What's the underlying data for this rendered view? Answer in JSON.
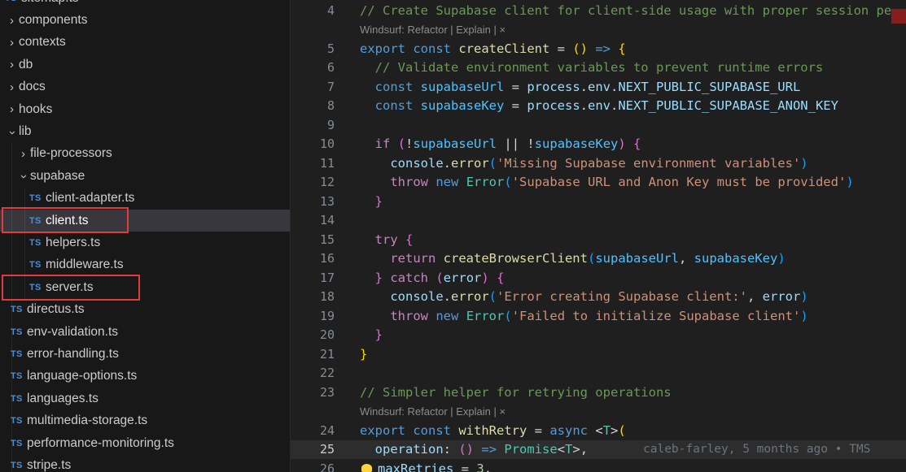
{
  "sidebar": {
    "items": [
      {
        "label": "sitemap.ts",
        "kind": "file",
        "level": 0,
        "partial": true
      },
      {
        "label": "components",
        "kind": "folder",
        "level": 0,
        "expanded": false
      },
      {
        "label": "contexts",
        "kind": "folder",
        "level": 0,
        "expanded": false
      },
      {
        "label": "db",
        "kind": "folder",
        "level": 0,
        "expanded": false
      },
      {
        "label": "docs",
        "kind": "folder",
        "level": 0,
        "expanded": false
      },
      {
        "label": "hooks",
        "kind": "folder",
        "level": 0,
        "expanded": false
      },
      {
        "label": "lib",
        "kind": "folder",
        "level": 0,
        "expanded": true
      },
      {
        "label": "file-processors",
        "kind": "folder",
        "level": 1,
        "expanded": false
      },
      {
        "label": "supabase",
        "kind": "folder",
        "level": 1,
        "expanded": true
      },
      {
        "label": "client-adapter.ts",
        "kind": "file",
        "level": 2
      },
      {
        "label": "client.ts",
        "kind": "file",
        "level": 2,
        "selected": true,
        "annotated": true
      },
      {
        "label": "helpers.ts",
        "kind": "file",
        "level": 2
      },
      {
        "label": "middleware.ts",
        "kind": "file",
        "level": 2
      },
      {
        "label": "server.ts",
        "kind": "file",
        "level": 2,
        "annotated": true
      },
      {
        "label": "directus.ts",
        "kind": "file",
        "level": 1
      },
      {
        "label": "env-validation.ts",
        "kind": "file",
        "level": 1
      },
      {
        "label": "error-handling.ts",
        "kind": "file",
        "level": 1
      },
      {
        "label": "language-options.ts",
        "kind": "file",
        "level": 1
      },
      {
        "label": "languages.ts",
        "kind": "file",
        "level": 1
      },
      {
        "label": "multimedia-storage.ts",
        "kind": "file",
        "level": 1
      },
      {
        "label": "performance-monitoring.ts",
        "kind": "file",
        "level": 1
      },
      {
        "label": "stripe.ts",
        "kind": "file",
        "level": 1,
        "partial": true
      }
    ]
  },
  "annotations": {
    "boxes": [
      "client.ts",
      "server.ts"
    ],
    "color": "#e03c3c"
  },
  "editor": {
    "rows": [
      {
        "n": "4",
        "tokens": [
          [
            "// Create Supabase client for client-side usage with proper session pe",
            "cm"
          ]
        ]
      },
      {
        "n": "",
        "lens": true,
        "tokens": [
          [
            "Windsurf: Refactor",
            "lens",
            "codelens-refactor-link",
            true
          ],
          [
            " | ",
            "lens"
          ],
          [
            "Explain",
            "lens",
            "codelens-explain-link",
            true
          ],
          [
            " | ",
            "lens"
          ],
          [
            "×",
            "lens-close",
            "codelens-dismiss-icon",
            true
          ]
        ]
      },
      {
        "n": "5",
        "tokens": [
          [
            "export ",
            "kw"
          ],
          [
            "const ",
            "kw"
          ],
          [
            "createClient",
            "fn"
          ],
          [
            " = ",
            "pl"
          ],
          [
            "()",
            "b1"
          ],
          [
            " ",
            "pl"
          ],
          [
            "=>",
            "kw"
          ],
          [
            " ",
            "pl"
          ],
          [
            "{",
            "b1"
          ]
        ]
      },
      {
        "n": "6",
        "tokens": [
          [
            "  ",
            "pl"
          ],
          [
            "// Validate environment variables to prevent runtime errors",
            "cm"
          ]
        ]
      },
      {
        "n": "7",
        "tokens": [
          [
            "  ",
            "pl"
          ],
          [
            "const ",
            "kw"
          ],
          [
            "supabaseUrl",
            "cv"
          ],
          [
            " = ",
            "pl"
          ],
          [
            "process",
            "vr"
          ],
          [
            ".",
            "pl"
          ],
          [
            "env",
            "vr"
          ],
          [
            ".",
            "pl"
          ],
          [
            "NEXT_PUBLIC_SUPABASE_URL",
            "vr"
          ]
        ]
      },
      {
        "n": "8",
        "tokens": [
          [
            "  ",
            "pl"
          ],
          [
            "const ",
            "kw"
          ],
          [
            "supabaseKey",
            "cv"
          ],
          [
            " = ",
            "pl"
          ],
          [
            "process",
            "vr"
          ],
          [
            ".",
            "pl"
          ],
          [
            "env",
            "vr"
          ],
          [
            ".",
            "pl"
          ],
          [
            "NEXT_PUBLIC_SUPABASE_ANON_KEY",
            "vr"
          ]
        ]
      },
      {
        "n": "9",
        "tokens": []
      },
      {
        "n": "10",
        "tokens": [
          [
            "  ",
            "pl"
          ],
          [
            "if",
            "ctl"
          ],
          [
            " ",
            "pl"
          ],
          [
            "(",
            "b2"
          ],
          [
            "!",
            "pl"
          ],
          [
            "supabaseUrl",
            "cv"
          ],
          [
            " || ",
            "pl"
          ],
          [
            "!",
            "pl"
          ],
          [
            "supabaseKey",
            "cv"
          ],
          [
            ")",
            "b2"
          ],
          [
            " ",
            "pl"
          ],
          [
            "{",
            "b2"
          ]
        ]
      },
      {
        "n": "11",
        "tokens": [
          [
            "    ",
            "pl"
          ],
          [
            "console",
            "vr"
          ],
          [
            ".",
            "pl"
          ],
          [
            "error",
            "fn"
          ],
          [
            "(",
            "b3"
          ],
          [
            "'Missing Supabase environment variables'",
            "st"
          ],
          [
            ")",
            "b3"
          ]
        ]
      },
      {
        "n": "12",
        "tokens": [
          [
            "    ",
            "pl"
          ],
          [
            "throw",
            "ctl"
          ],
          [
            " ",
            "pl"
          ],
          [
            "new",
            "kw"
          ],
          [
            " ",
            "pl"
          ],
          [
            "Error",
            "cl"
          ],
          [
            "(",
            "b3"
          ],
          [
            "'Supabase URL and Anon Key must be provided'",
            "st"
          ],
          [
            ")",
            "b3"
          ]
        ]
      },
      {
        "n": "13",
        "tokens": [
          [
            "  ",
            "pl"
          ],
          [
            "}",
            "b2"
          ]
        ]
      },
      {
        "n": "14",
        "tokens": []
      },
      {
        "n": "15",
        "tokens": [
          [
            "  ",
            "pl"
          ],
          [
            "try",
            "ctl"
          ],
          [
            " ",
            "pl"
          ],
          [
            "{",
            "b2"
          ]
        ]
      },
      {
        "n": "16",
        "tokens": [
          [
            "    ",
            "pl"
          ],
          [
            "return",
            "ctl"
          ],
          [
            " ",
            "pl"
          ],
          [
            "createBrowserClient",
            "fn"
          ],
          [
            "(",
            "b3"
          ],
          [
            "supabaseUrl",
            "cv"
          ],
          [
            ", ",
            "pl"
          ],
          [
            "supabaseKey",
            "cv"
          ],
          [
            ")",
            "b3"
          ]
        ]
      },
      {
        "n": "17",
        "tokens": [
          [
            "  ",
            "pl"
          ],
          [
            "}",
            "b2"
          ],
          [
            " ",
            "pl"
          ],
          [
            "catch",
            "ctl"
          ],
          [
            " ",
            "pl"
          ],
          [
            "(",
            "b2"
          ],
          [
            "error",
            "vr"
          ],
          [
            ")",
            "b2"
          ],
          [
            " ",
            "pl"
          ],
          [
            "{",
            "b2"
          ]
        ]
      },
      {
        "n": "18",
        "tokens": [
          [
            "    ",
            "pl"
          ],
          [
            "console",
            "vr"
          ],
          [
            ".",
            "pl"
          ],
          [
            "error",
            "fn"
          ],
          [
            "(",
            "b3"
          ],
          [
            "'Error creating Supabase client:'",
            "st"
          ],
          [
            ", ",
            "pl"
          ],
          [
            "error",
            "vr"
          ],
          [
            ")",
            "b3"
          ]
        ]
      },
      {
        "n": "19",
        "tokens": [
          [
            "    ",
            "pl"
          ],
          [
            "throw",
            "ctl"
          ],
          [
            " ",
            "pl"
          ],
          [
            "new",
            "kw"
          ],
          [
            " ",
            "pl"
          ],
          [
            "Error",
            "cl"
          ],
          [
            "(",
            "b3"
          ],
          [
            "'Failed to initialize Supabase client'",
            "st"
          ],
          [
            ")",
            "b3"
          ]
        ]
      },
      {
        "n": "20",
        "tokens": [
          [
            "  ",
            "pl"
          ],
          [
            "}",
            "b2"
          ]
        ]
      },
      {
        "n": "21",
        "tokens": [
          [
            "}",
            "b1"
          ]
        ]
      },
      {
        "n": "22",
        "tokens": []
      },
      {
        "n": "23",
        "tokens": [
          [
            "// Simpler helper for retrying operations",
            "cm"
          ]
        ]
      },
      {
        "n": "",
        "lens": true,
        "tokens": [
          [
            "Windsurf: Refactor",
            "lens",
            "codelens-refactor-link",
            true
          ],
          [
            " | ",
            "lens"
          ],
          [
            "Explain",
            "lens",
            "codelens-explain-link",
            true
          ],
          [
            " | ",
            "lens"
          ],
          [
            "×",
            "lens-close",
            "codelens-dismiss-icon",
            true
          ]
        ]
      },
      {
        "n": "24",
        "tokens": [
          [
            "export ",
            "kw"
          ],
          [
            "const ",
            "kw"
          ],
          [
            "withRetry",
            "fn"
          ],
          [
            " = ",
            "pl"
          ],
          [
            "async",
            "kw"
          ],
          [
            " ",
            "pl"
          ],
          [
            "<",
            "pl"
          ],
          [
            "T",
            "cl"
          ],
          [
            ">",
            "pl"
          ],
          [
            "(",
            "b1"
          ]
        ]
      },
      {
        "n": "25",
        "current": true,
        "blame": "caleb-farley, 5 months ago • TMS",
        "tokens": [
          [
            "  ",
            "pl"
          ],
          [
            "operation",
            "vr"
          ],
          [
            ": ",
            "pl"
          ],
          [
            "()",
            "b2"
          ],
          [
            " ",
            "pl"
          ],
          [
            "=>",
            "kw"
          ],
          [
            " ",
            "pl"
          ],
          [
            "Promise",
            "cl"
          ],
          [
            "<",
            "pl"
          ],
          [
            "T",
            "cl"
          ],
          [
            ">",
            "pl"
          ],
          [
            ",",
            "pl"
          ]
        ]
      },
      {
        "n": "26",
        "bulb": true,
        "tokens": [
          [
            "maxRetries",
            "vr"
          ],
          [
            " = ",
            "pl"
          ],
          [
            "3",
            "nm"
          ],
          [
            ",",
            "pl"
          ]
        ]
      }
    ]
  },
  "colors": {
    "bg-editor": "#1f1f1f",
    "bg-sidebar": "#181818",
    "selection-bg": "#37373d",
    "sidebar-fg": "#cccccc",
    "line-number": "#848d97",
    "line-number-active": "#c9d1d9",
    "current-line-bg": "#2d2d2d",
    "cm": "#6a9955",
    "kw": "#569cd6",
    "ctl": "#c586c0",
    "fn": "#dcdcaa",
    "vr": "#9cdcfe",
    "cv": "#4fc1ff",
    "st": "#ce9178",
    "cl": "#4ec9b0",
    "nm": "#b5cea8",
    "pl": "#d4d4d4",
    "b1": "#ffd700",
    "b2": "#da70d6",
    "b3": "#179fff",
    "lens": "#8c8c8c",
    "blame": "#6b737c",
    "ts-icon": "#4a8fd6",
    "annotation": "#e03c3c",
    "bulb": "#ffd33d"
  }
}
